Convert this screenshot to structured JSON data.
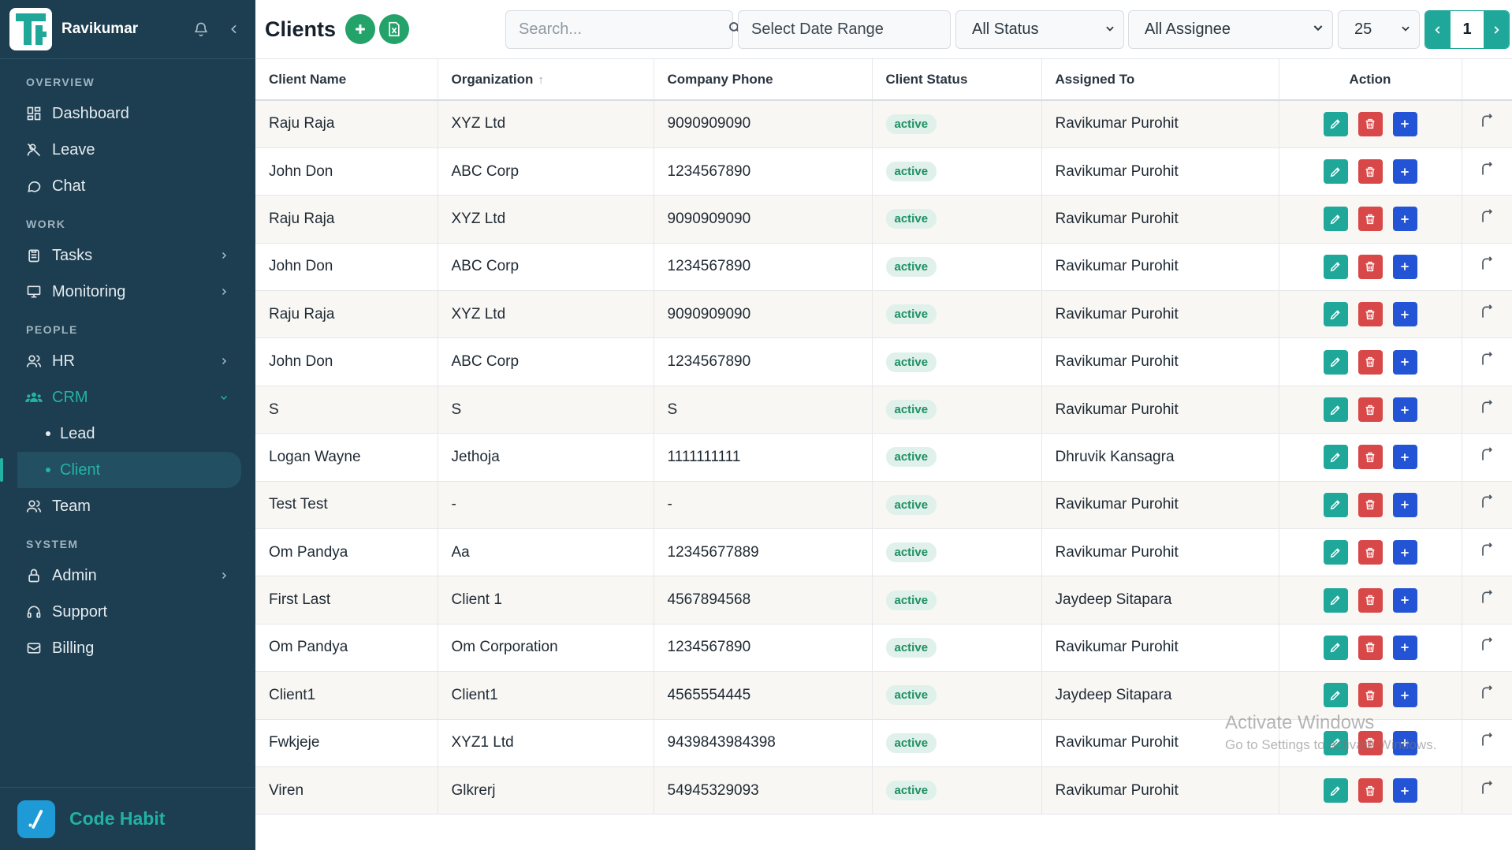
{
  "sidebar": {
    "user_name": "Ravikumar",
    "sections": {
      "overview": "OVERVIEW",
      "work": "WORK",
      "people": "PEOPLE",
      "system": "SYSTEM"
    },
    "items": {
      "dashboard": "Dashboard",
      "leave": "Leave",
      "chat": "Chat",
      "tasks": "Tasks",
      "monitoring": "Monitoring",
      "hr": "HR",
      "crm": "CRM",
      "lead": "Lead",
      "client": "Client",
      "team": "Team",
      "admin": "Admin",
      "support": "Support",
      "billing": "Billing"
    },
    "footer_name": "Code Habit"
  },
  "header": {
    "title": "Clients",
    "search_placeholder": "Search...",
    "date_range": "Select Date Range",
    "status_filter": "All Status",
    "assignee_filter": "All Assignee",
    "page_size": "25",
    "current_page": "1"
  },
  "table": {
    "columns": [
      "Client Name",
      "Organization",
      "Company Phone",
      "Client Status",
      "Assigned To",
      "Action"
    ],
    "rows": [
      {
        "name": "Raju Raja",
        "org": "XYZ Ltd",
        "phone": "9090909090",
        "status": "active",
        "assigned": "Ravikumar Purohit"
      },
      {
        "name": "John Don",
        "org": "ABC Corp",
        "phone": "1234567890",
        "status": "active",
        "assigned": "Ravikumar Purohit"
      },
      {
        "name": "Raju Raja",
        "org": "XYZ Ltd",
        "phone": "9090909090",
        "status": "active",
        "assigned": "Ravikumar Purohit"
      },
      {
        "name": "John Don",
        "org": "ABC Corp",
        "phone": "1234567890",
        "status": "active",
        "assigned": "Ravikumar Purohit"
      },
      {
        "name": "Raju Raja",
        "org": "XYZ Ltd",
        "phone": "9090909090",
        "status": "active",
        "assigned": "Ravikumar Purohit"
      },
      {
        "name": "John Don",
        "org": "ABC Corp",
        "phone": "1234567890",
        "status": "active",
        "assigned": "Ravikumar Purohit"
      },
      {
        "name": "S",
        "org": "S",
        "phone": "S",
        "status": "active",
        "assigned": "Ravikumar Purohit"
      },
      {
        "name": "Logan Wayne",
        "org": "Jethoja",
        "phone": "1111111111",
        "status": "active",
        "assigned": "Dhruvik Kansagra"
      },
      {
        "name": "Test Test",
        "org": "-",
        "phone": "-",
        "status": "active",
        "assigned": "Ravikumar Purohit"
      },
      {
        "name": "Om Pandya",
        "org": "Aa",
        "phone": "12345677889",
        "status": "active",
        "assigned": "Ravikumar Purohit"
      },
      {
        "name": "First Last",
        "org": "Client 1",
        "phone": "4567894568",
        "status": "active",
        "assigned": "Jaydeep Sitapara"
      },
      {
        "name": "Om Pandya",
        "org": "Om Corporation",
        "phone": "1234567890",
        "status": "active",
        "assigned": "Ravikumar Purohit"
      },
      {
        "name": "Client1",
        "org": "Client1",
        "phone": "4565554445",
        "status": "active",
        "assigned": "Jaydeep Sitapara"
      },
      {
        "name": "Fwkjeje",
        "org": "XYZ1 Ltd",
        "phone": "9439843984398",
        "status": "active",
        "assigned": "Ravikumar Purohit"
      },
      {
        "name": "Viren",
        "org": "Glkrerj",
        "phone": "54945329093",
        "status": "active",
        "assigned": "Ravikumar Purohit"
      }
    ]
  },
  "watermark": {
    "line1": "Activate Windows",
    "line2": "Go to Settings to activate Windows."
  },
  "colors": {
    "sidebar_bg": "#1d3d50",
    "accent": "#1fa79a",
    "edit": "#1fa79a",
    "delete": "#d94848",
    "add": "#2454d6",
    "badge_bg": "#dff1ea",
    "badge_text": "#1f8f63"
  },
  "icons": {
    "edit": "pencil-icon",
    "delete": "trash-icon",
    "add": "plus-icon",
    "history": "undo-arrow-icon"
  }
}
